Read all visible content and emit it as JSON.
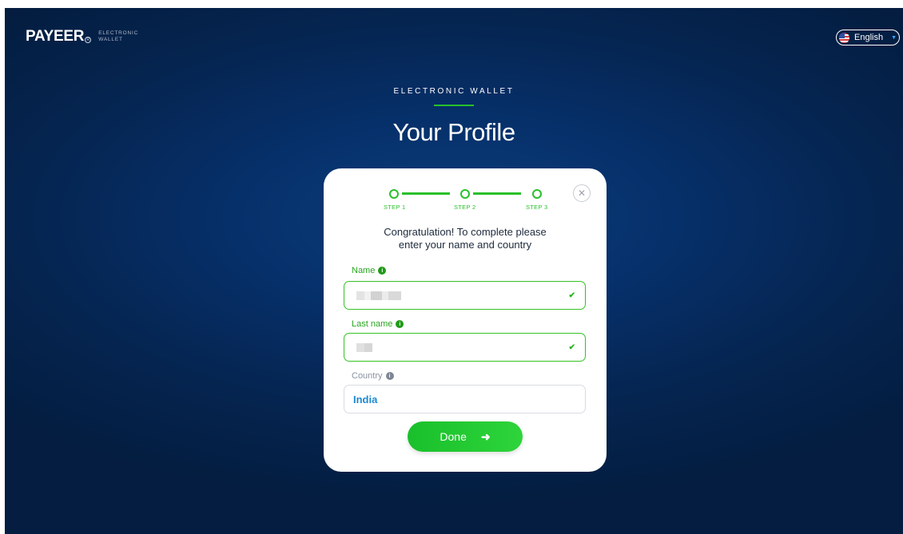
{
  "header": {
    "logo_text": "PAYEER",
    "logo_reg": "R",
    "logo_subtitle_line1": "ELECTRONIC",
    "logo_subtitle_line2": "WALLET",
    "language": "English",
    "language_icon": "us-flag-icon"
  },
  "hero": {
    "eyebrow": "ELECTRONIC WALLET",
    "title": "Your Profile"
  },
  "steps": [
    {
      "label": "STEP 1"
    },
    {
      "label": "STEP 2"
    },
    {
      "label": "STEP 3"
    }
  ],
  "form": {
    "intro_line1": "Congratulation! To complete please",
    "intro_line2": "enter your name and country",
    "name_label": "Name",
    "last_name_label": "Last name",
    "country_label": "Country",
    "country_value": "India",
    "done_label": "Done",
    "info_glyph": "i",
    "check_glyph": "✔",
    "arrow_glyph": "➜",
    "close_glyph": "✕"
  },
  "colors": {
    "accent_green": "#29c02a",
    "background_navy": "#05244f",
    "country_blue": "#1d8ad3"
  }
}
